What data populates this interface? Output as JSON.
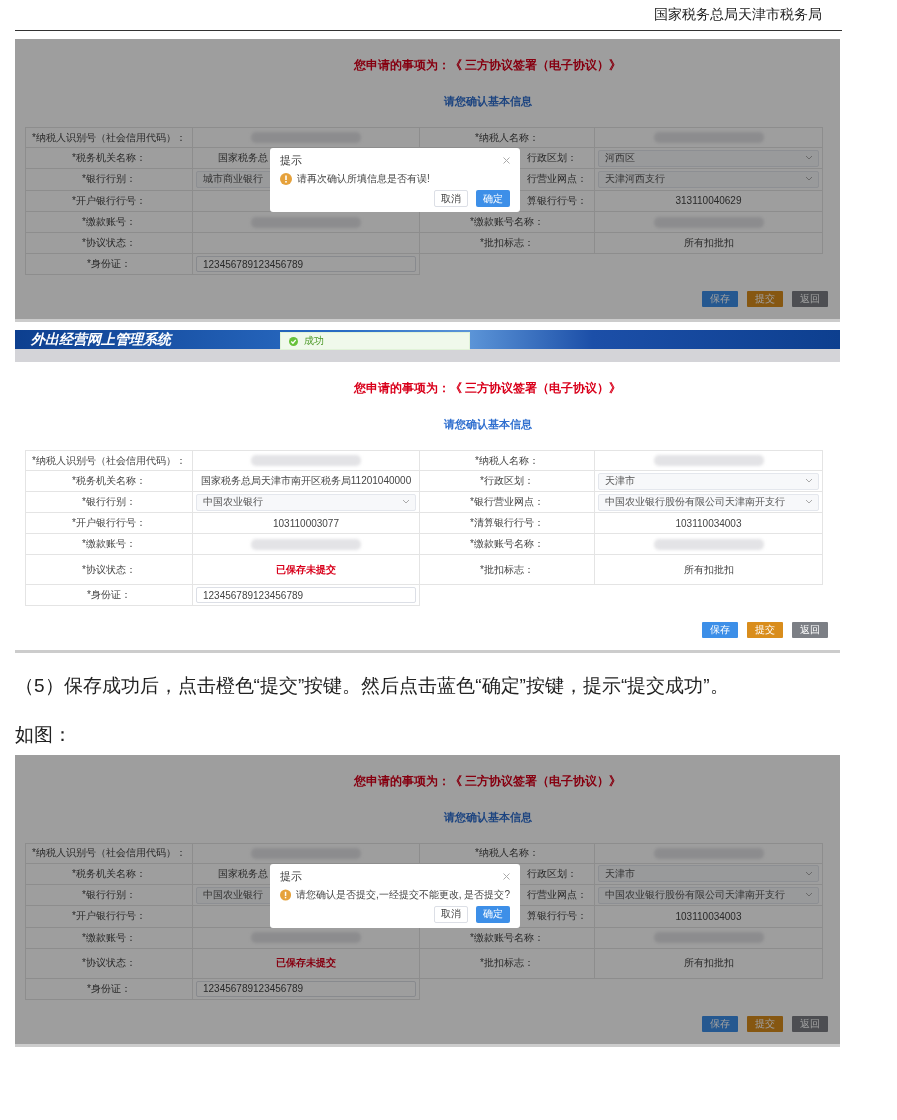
{
  "header": {
    "title": "国家税务总局天津市税务局"
  },
  "screenshots": [
    {
      "dimmed": true,
      "heading": "您申请的事项为：《 三方协议签署（电子协议）》",
      "subheading": "请您确认基本信息",
      "left": [
        {
          "label": "*纳税人识别号（社会信用代码）：",
          "kind": "blurred"
        },
        {
          "label": "*税务机关名称：",
          "value": "国家税务总",
          "kind": "text",
          "clipped": true
        },
        {
          "label": "*银行行别：",
          "value": "城市商业银行",
          "kind": "select"
        },
        {
          "label": "*开户银行行号：",
          "kind": "none"
        },
        {
          "label": "*缴款账号：",
          "kind": "blurred"
        },
        {
          "label": "*协议状态：",
          "kind": "none"
        },
        {
          "label": "*身份证：",
          "value": "123456789123456789",
          "kind": "input"
        }
      ],
      "right": [
        {
          "label": "*纳税人名称：",
          "kind": "blurred"
        },
        {
          "label": "行政区划：",
          "value": "河西区",
          "kind": "select",
          "clipped": true
        },
        {
          "label": "行营业网点：",
          "value": "天津河西支行",
          "kind": "select",
          "clipped": true
        },
        {
          "label": "算银行行号：",
          "value": "313110040629",
          "kind": "text",
          "clipped": true
        },
        {
          "label": "*缴款账号名称：",
          "kind": "blurred"
        },
        {
          "label": "*批扣标志：",
          "value": "所有扣批扣",
          "kind": "text"
        }
      ],
      "buttons": [
        {
          "label": "保存",
          "kind": "primary"
        },
        {
          "label": "提交",
          "kind": "warning"
        },
        {
          "label": "返回",
          "kind": "neutral"
        }
      ],
      "dialog": {
        "title": "提示",
        "message": "请再次确认所填信息是否有误!",
        "buttons": [
          {
            "label": "取消",
            "kind": "secondary"
          },
          {
            "label": "确定",
            "kind": "primary"
          }
        ]
      }
    },
    {
      "dimmed": false,
      "banner": {
        "title": "外出经营网上管理系统",
        "toast": "成功"
      },
      "heading": "您申请的事项为：《 三方协议签署（电子协议）》",
      "subheading": "请您确认基本信息",
      "left": [
        {
          "label": "*纳税人识别号（社会信用代码）：",
          "kind": "blurred"
        },
        {
          "label": "*税务机关名称：",
          "value": "国家税务总局天津市南开区税务局11201040000",
          "kind": "text"
        },
        {
          "label": "*银行行别：",
          "value": "中国农业银行",
          "kind": "select"
        },
        {
          "label": "*开户银行行号：",
          "value": "103110003077",
          "kind": "text"
        },
        {
          "label": "*缴款账号：",
          "kind": "blurred"
        },
        {
          "label": "*协议状态：",
          "value": "已保存未提交",
          "kind": "status"
        },
        {
          "label": "*身份证：",
          "value": "123456789123456789",
          "kind": "input"
        }
      ],
      "right": [
        {
          "label": "*纳税人名称：",
          "kind": "blurred"
        },
        {
          "label": "*行政区划：",
          "value": "天津市",
          "kind": "select"
        },
        {
          "label": "*银行营业网点：",
          "value": "中国农业银行股份有限公司天津南开支行",
          "kind": "select"
        },
        {
          "label": "*清算银行行号：",
          "value": "103110034003",
          "kind": "text"
        },
        {
          "label": "*缴款账号名称：",
          "kind": "blurred"
        },
        {
          "label": "*批扣标志：",
          "value": "所有扣批扣",
          "kind": "text"
        }
      ],
      "buttons": [
        {
          "label": "保存",
          "kind": "primary"
        },
        {
          "label": "提交",
          "kind": "warning"
        },
        {
          "label": "返回",
          "kind": "neutral"
        }
      ]
    },
    {
      "kind": "caption",
      "paragraphs": [
        "（5）保存成功后，点击橙色“提交”按键。然后点击蓝色“确定”按键，提示“提交成功”。",
        "如图："
      ]
    },
    {
      "dimmed": true,
      "heading": "您申请的事项为：《 三方协议签署（电子协议）》",
      "subheading": "请您确认基本信息",
      "left": [
        {
          "label": "*纳税人识别号（社会信用代码）：",
          "kind": "blurred"
        },
        {
          "label": "*税务机关名称：",
          "value": "国家税务总",
          "kind": "text",
          "clipped": true
        },
        {
          "label": "*银行行别：",
          "value": "中国农业银行",
          "kind": "select"
        },
        {
          "label": "*开户银行行号：",
          "kind": "none"
        },
        {
          "label": "*缴款账号：",
          "kind": "blurred"
        },
        {
          "label": "*协议状态：",
          "value": "已保存未提交",
          "kind": "status"
        },
        {
          "label": "*身份证：",
          "value": "123456789123456789",
          "kind": "input"
        }
      ],
      "right": [
        {
          "label": "*纳税人名称：",
          "kind": "blurred"
        },
        {
          "label": "行政区划：",
          "value": "天津市",
          "kind": "select",
          "clipped": true
        },
        {
          "label": "行营业网点：",
          "value": "中国农业银行股份有限公司天津南开支行",
          "kind": "select",
          "clipped": true
        },
        {
          "label": "算银行行号：",
          "value": "103110034003",
          "kind": "text",
          "clipped": true
        },
        {
          "label": "*缴款账号名称：",
          "kind": "blurred"
        },
        {
          "label": "*批扣标志：",
          "value": "所有扣批扣",
          "kind": "text"
        }
      ],
      "buttons": [
        {
          "label": "保存",
          "kind": "primary"
        },
        {
          "label": "提交",
          "kind": "warning"
        },
        {
          "label": "返回",
          "kind": "neutral"
        }
      ],
      "dialog": {
        "title": "提示",
        "message": "请您确认是否提交,一经提交不能更改, 是否提交?",
        "buttons": [
          {
            "label": "取消",
            "kind": "secondary"
          },
          {
            "label": "确定",
            "kind": "primary"
          }
        ]
      }
    }
  ]
}
